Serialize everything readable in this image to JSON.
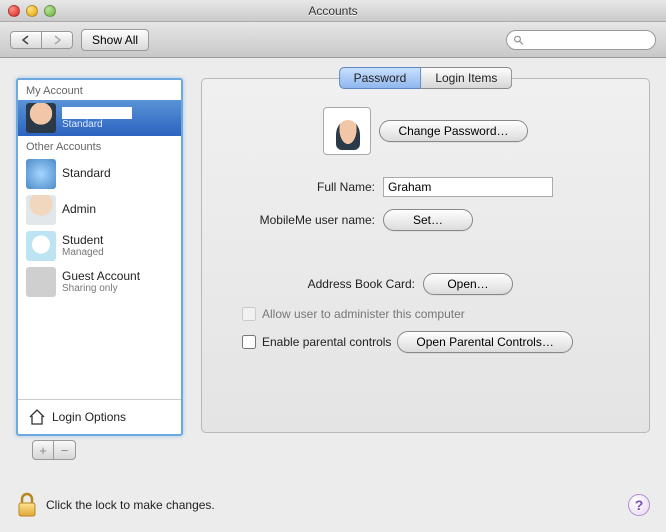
{
  "window": {
    "title": "Accounts"
  },
  "toolbar": {
    "show_all": "Show All",
    "search_placeholder": ""
  },
  "sidebar": {
    "my_account_header": "My Account",
    "other_accounts_header": "Other Accounts",
    "my_account": {
      "name": "",
      "role": "Standard"
    },
    "others": [
      {
        "name": "Standard",
        "role": ""
      },
      {
        "name": "Admin",
        "role": ""
      },
      {
        "name": "Student",
        "role": "Managed"
      },
      {
        "name": "Guest Account",
        "role": "Sharing only"
      }
    ],
    "login_options": "Login Options"
  },
  "tabs": {
    "password": "Password",
    "login_items": "Login Items"
  },
  "main": {
    "change_password": "Change Password…",
    "full_name_label": "Full Name:",
    "full_name_value": "Graham",
    "mobileme_label": "MobileMe user name:",
    "mobileme_set": "Set…",
    "address_card_label": "Address Book Card:",
    "open": "Open…",
    "admin_check": "Allow user to administer this computer",
    "parental_check": "Enable parental controls",
    "open_parental": "Open Parental Controls…"
  },
  "footer": {
    "lock_text": "Click the lock to make changes."
  }
}
